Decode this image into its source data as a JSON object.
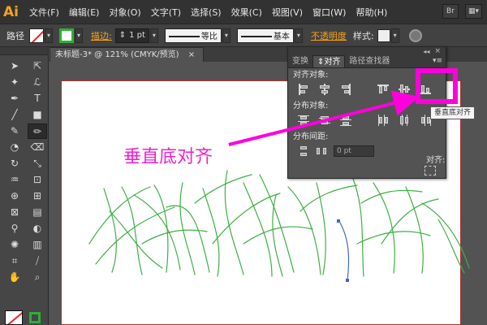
{
  "menubar": {
    "logo": "Ai",
    "items": [
      "文件(F)",
      "编辑(E)",
      "对象(O)",
      "文字(T)",
      "选择(S)",
      "效果(C)",
      "视图(V)",
      "窗口(W)",
      "帮助(H)"
    ],
    "bridge_label": "Br"
  },
  "controlbar": {
    "mode_label": "路径",
    "stroke_label": "描边:",
    "stroke_weight": "1 pt",
    "profile_label": "等比",
    "brush_label": "基本",
    "opacity_label": "不透明度",
    "style_label": "样式:",
    "stroke_color": "#2fae37"
  },
  "document": {
    "tab_title": "未标题-3* @ 121% (CMYK/预览)"
  },
  "align_panel": {
    "tabs": [
      "变换",
      "对齐",
      "路径查找器"
    ],
    "active_tab": "对齐",
    "align_objects_label": "对齐对象:",
    "distribute_objects_label": "分布对象:",
    "distribute_spacing_label": "分布间距:",
    "spacing_value": "0 pt",
    "align_to_label": "对齐:",
    "tooltip": "垂直底对齐"
  },
  "annotation": {
    "text": "垂直底对齐",
    "color": "#ee22cc"
  },
  "colors": {
    "highlight": "#ff00dd",
    "grass_stroke": "#3cb043",
    "selected_path": "#4466cc"
  }
}
